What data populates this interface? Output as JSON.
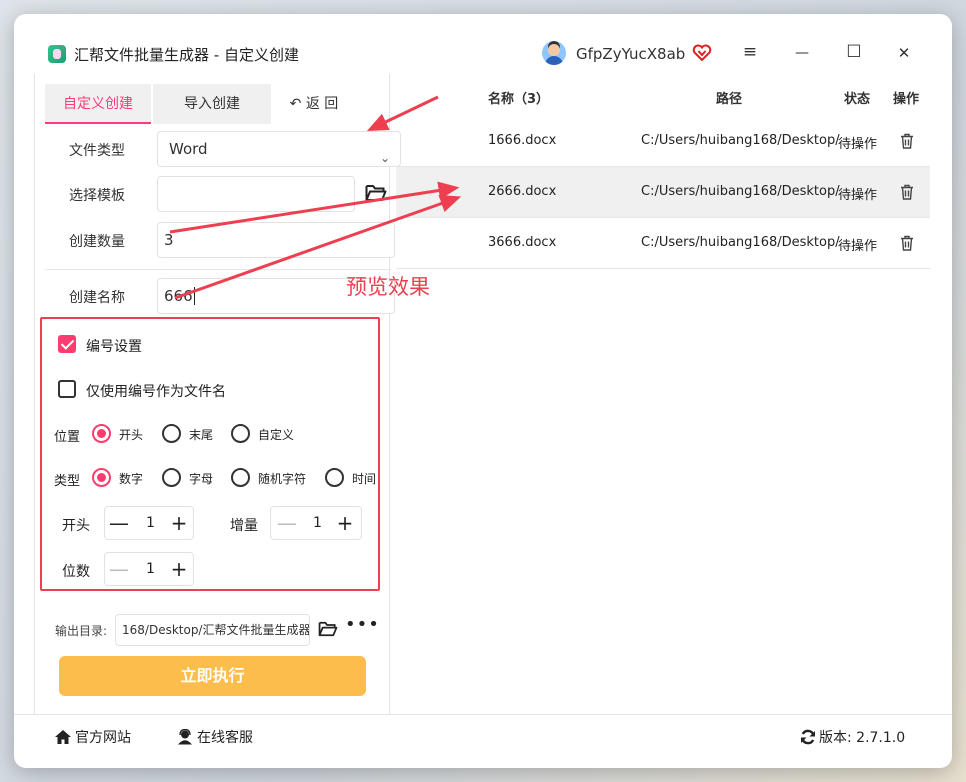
{
  "window": {
    "title": "汇帮文件批量生成器 - 自定义创建",
    "username": "GfpZyYucX8ab"
  },
  "window_controls": {
    "menu": "≡",
    "minimize": "—",
    "maximize": "☐",
    "close": "✕"
  },
  "tabs": {
    "custom": "自定义创建",
    "import": "导入创建",
    "back": "返 回",
    "back_icon": "↶"
  },
  "form": {
    "file_type_label": "文件类型",
    "file_type_value": "Word",
    "template_label": "选择模板",
    "template_value": "",
    "count_label": "创建数量",
    "count_value": "3",
    "name_label": "创建名称",
    "name_value": "666"
  },
  "numbering": {
    "enable_label": "编号设置",
    "enabled": true,
    "only_number_label": "仅使用编号作为文件名",
    "only_number": false,
    "position_label": "位置",
    "position_options": [
      "开头",
      "末尾",
      "自定义"
    ],
    "position_selected": "开头",
    "type_label": "类型",
    "type_options": [
      "数字",
      "字母",
      "随机字符",
      "时间"
    ],
    "type_selected": "数字",
    "start_label": "开头",
    "start_value": "1",
    "increment_label": "增量",
    "increment_value": "1",
    "digits_label": "位数",
    "digits_value": "1",
    "minus": "—",
    "plus": "+"
  },
  "output": {
    "label": "输出目录:",
    "value": "168/Desktop/汇帮文件批量生成器",
    "more": "•••"
  },
  "run_button": "立即执行",
  "table": {
    "headers": {
      "name": "名称（3）",
      "path": "路径",
      "status": "状态",
      "action": "操作"
    },
    "rows": [
      {
        "name": "1666.docx",
        "path": "C:/Users/huibang168/Desktop/",
        "status": "待操作"
      },
      {
        "name": "2666.docx",
        "path": "C:/Users/huibang168/Desktop/",
        "status": "待操作"
      },
      {
        "name": "3666.docx",
        "path": "C:/Users/huibang168/Desktop/",
        "status": "待操作"
      }
    ]
  },
  "annotation": "预览效果",
  "footer": {
    "website": "官方网站",
    "support": "在线客服",
    "version": "版本: 2.7.1.0"
  },
  "colors": {
    "accent": "#ff3b6f",
    "annotation": "#ee3f50",
    "run_button": "#fbbd4c"
  }
}
